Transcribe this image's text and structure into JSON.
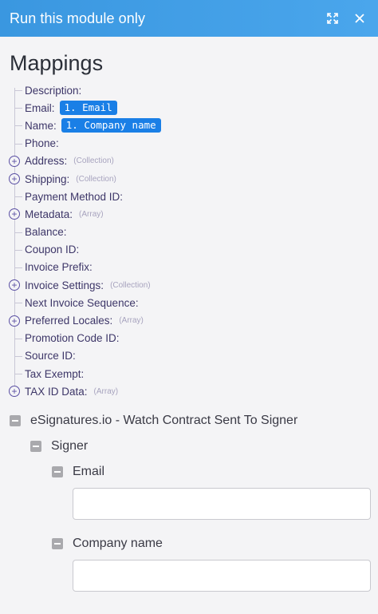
{
  "header": {
    "title": "Run this module only"
  },
  "mappings": {
    "title": "Mappings",
    "rows": [
      {
        "label": "Description:"
      },
      {
        "label": "Email:",
        "pill": "1. Email"
      },
      {
        "label": "Name:",
        "pill": "1. Company name"
      },
      {
        "label": "Phone:"
      },
      {
        "label": "Address:",
        "hint": "(Collection)",
        "expandable": true
      },
      {
        "label": "Shipping:",
        "hint": "(Collection)",
        "expandable": true
      },
      {
        "label": "Payment Method ID:"
      },
      {
        "label": "Metadata:",
        "hint": "(Array)",
        "expandable": true
      },
      {
        "label": "Balance:"
      },
      {
        "label": "Coupon ID:"
      },
      {
        "label": "Invoice Prefix:"
      },
      {
        "label": "Invoice Settings:",
        "hint": "(Collection)",
        "expandable": true
      },
      {
        "label": "Next Invoice Sequence:"
      },
      {
        "label": "Preferred Locales:",
        "hint": "(Array)",
        "expandable": true
      },
      {
        "label": "Promotion Code ID:"
      },
      {
        "label": "Source ID:"
      },
      {
        "label": "Tax Exempt:"
      },
      {
        "label": "TAX ID Data:",
        "hint": "(Array)",
        "expandable": true
      }
    ]
  },
  "source": {
    "module": "eSignatures.io - Watch Contract Sent To Signer",
    "group": "Signer",
    "fields": [
      {
        "label": "Email",
        "value": ""
      },
      {
        "label": "Company name",
        "value": ""
      }
    ]
  }
}
